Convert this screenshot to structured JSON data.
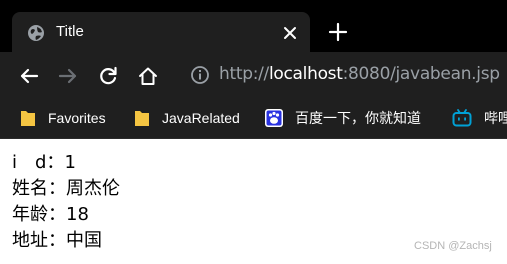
{
  "tab": {
    "title": "Title"
  },
  "address_bar": {
    "scheme": "http://",
    "host": "localhost",
    "rest": ":8080/javabean.jsp"
  },
  "bookmarks": [
    {
      "label": "Favorites",
      "icon": "folder-icon"
    },
    {
      "label": "JavaRelated",
      "icon": "folder-icon"
    },
    {
      "label": "百度一下，你就知道",
      "icon": "baidu-icon"
    },
    {
      "label": "哔哩",
      "icon": "bilibili-icon"
    }
  ],
  "content": {
    "rows": [
      {
        "label": "i　d：",
        "value": "1"
      },
      {
        "label": "姓名：",
        "value": "周杰伦"
      },
      {
        "label": "年龄：",
        "value": "18"
      },
      {
        "label": "地址：",
        "value": "中国"
      }
    ]
  },
  "watermark": "CSDN @Zachsj",
  "colors": {
    "tabstrip": "#000000",
    "toolbar": "#1f1f1f",
    "folder": "#f5c542",
    "baidu": "#2932e1",
    "bilibili": "#00a1d6"
  }
}
